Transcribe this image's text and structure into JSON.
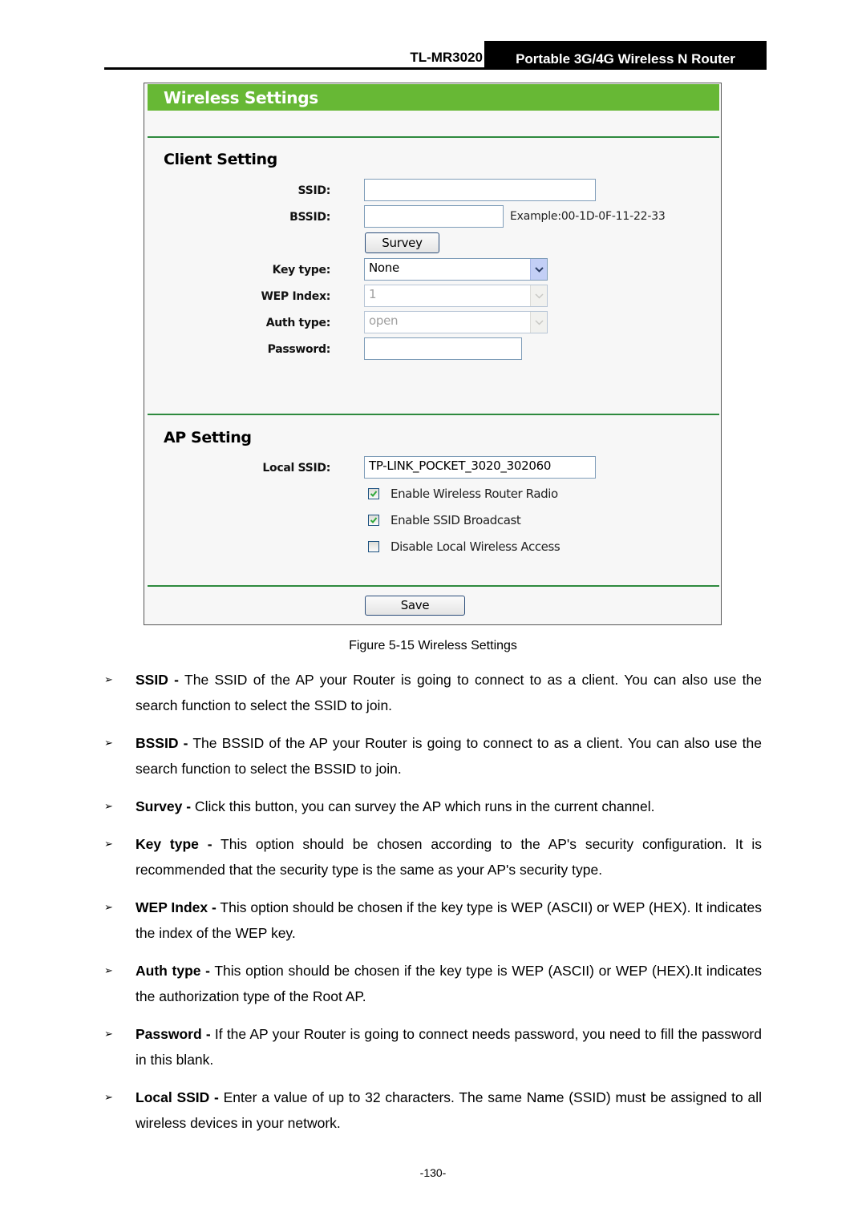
{
  "header": {
    "model": "TL-MR3020",
    "product": "Portable 3G/4G Wireless N Router"
  },
  "figure": {
    "window_title": "Wireless Settings",
    "client_section": {
      "title": "Client Setting",
      "ssid_label": "SSID:",
      "ssid_value": "",
      "bssid_label": "BSSID:",
      "bssid_value": "",
      "bssid_hint": "Example:00-1D-0F-11-22-33",
      "survey_button": "Survey",
      "key_type_label": "Key type:",
      "key_type_value": "None",
      "wep_index_label": "WEP Index:",
      "wep_index_value": "1",
      "auth_type_label": "Auth type:",
      "auth_type_value": "open",
      "password_label": "Password:",
      "password_value": ""
    },
    "ap_section": {
      "title": "AP Setting",
      "local_ssid_label": "Local SSID:",
      "local_ssid_value": "TP-LINK_POCKET_3020_302060",
      "checkboxes": [
        {
          "label": "Enable Wireless Router Radio",
          "checked": true
        },
        {
          "label": "Enable SSID Broadcast",
          "checked": true
        },
        {
          "label": "Disable Local Wireless Access",
          "checked": false
        }
      ]
    },
    "save_button": "Save",
    "colors": {
      "title_bar": "#67b835",
      "rule": "#2e8a3e",
      "check": "#2fa83a"
    }
  },
  "caption": "Figure 5-15 Wireless Settings",
  "bullets": [
    {
      "term": "SSID -",
      "text": " The SSID of the AP your Router is going to connect to as a client. You can also use the search function to select the SSID to join."
    },
    {
      "term": "BSSID -",
      "text": " The BSSID of the AP your Router is going to connect to as a client. You can also use the search function to select the BSSID to join."
    },
    {
      "term": "Survey -",
      "text": " Click this button, you can survey the AP which runs in the current channel."
    },
    {
      "term": "Key type -",
      "text": " This option should be chosen according to the AP's security configuration. It is recommended that the security type is the same as your AP's security type."
    },
    {
      "term": "WEP Index -",
      "text": " This option should be chosen if the key type is WEP (ASCII) or WEP (HEX). It indicates the index of the WEP key."
    },
    {
      "term": "Auth type -",
      "text": " This option should be chosen if the key type is WEP (ASCII) or WEP (HEX).It indicates the authorization type of the Root AP."
    },
    {
      "term": "Password -",
      "text": " If the AP your Router is going to connect needs password, you need to fill the password in this blank."
    },
    {
      "term": "Local SSID -",
      "text": " Enter a value of up to 32 characters. The same Name (SSID) must be assigned to all wireless devices in your network."
    }
  ],
  "bullet_glyph": "➢",
  "page_number": "-130-"
}
